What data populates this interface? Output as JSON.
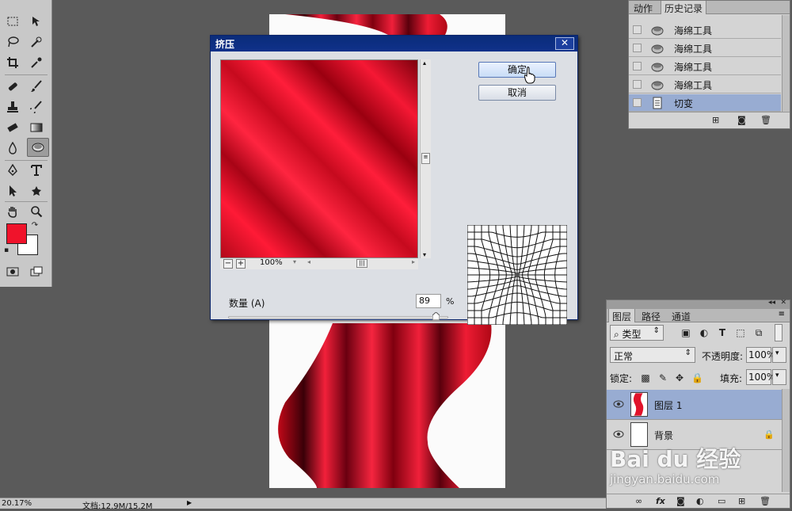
{
  "toolbar": {
    "tools": [
      "marquee-tool",
      "move-tool",
      "lasso-tool",
      "quick-select-tool",
      "crop-tool",
      "eyedropper-tool",
      "healing-brush-tool",
      "brush-tool",
      "clone-stamp-tool",
      "history-brush-tool",
      "eraser-tool",
      "gradient-tool",
      "blur-tool",
      "sponge-tool",
      "pen-tool",
      "type-tool",
      "path-select-tool",
      "custom-shape-tool",
      "hand-tool",
      "zoom-tool"
    ],
    "active_tool": "sponge-tool",
    "foreground_color": "#f0132b",
    "background_color": "#ffffff"
  },
  "status": {
    "zoom": "20.17%",
    "doc": "文档:12.9M/15.2M"
  },
  "history_panel": {
    "tabs": [
      "动作",
      "历史记录"
    ],
    "active_tab": "历史记录",
    "rows": [
      {
        "label": "海绵工具",
        "icon": "sponge-icon"
      },
      {
        "label": "海绵工具",
        "icon": "sponge-icon"
      },
      {
        "label": "海绵工具",
        "icon": "sponge-icon"
      },
      {
        "label": "海绵工具",
        "icon": "sponge-icon"
      },
      {
        "label": "切变",
        "icon": "document-icon",
        "selected": true
      }
    ]
  },
  "layers_panel": {
    "tabs": [
      "图层",
      "路径",
      "通道"
    ],
    "active_tab": "图层",
    "filter_kind": "类型",
    "blend_mode": "正常",
    "opacity_label": "不透明度:",
    "opacity_value": "100%",
    "lock_label": "锁定:",
    "fill_label": "填充:",
    "fill_value": "100%",
    "layers": [
      {
        "name": "图层 1",
        "selected": true,
        "visible": true
      },
      {
        "name": "背景",
        "selected": false,
        "visible": true,
        "locked": true
      }
    ]
  },
  "dialog": {
    "title": "挤压",
    "ok_label": "确定",
    "cancel_label": "取消",
    "zoom_value": "100%",
    "amount_label": "数量 (A)",
    "amount_value": "89",
    "amount_unit": "%"
  },
  "watermark": {
    "brand": "Bai du 经验",
    "url": "jingyan.baidu.com"
  }
}
